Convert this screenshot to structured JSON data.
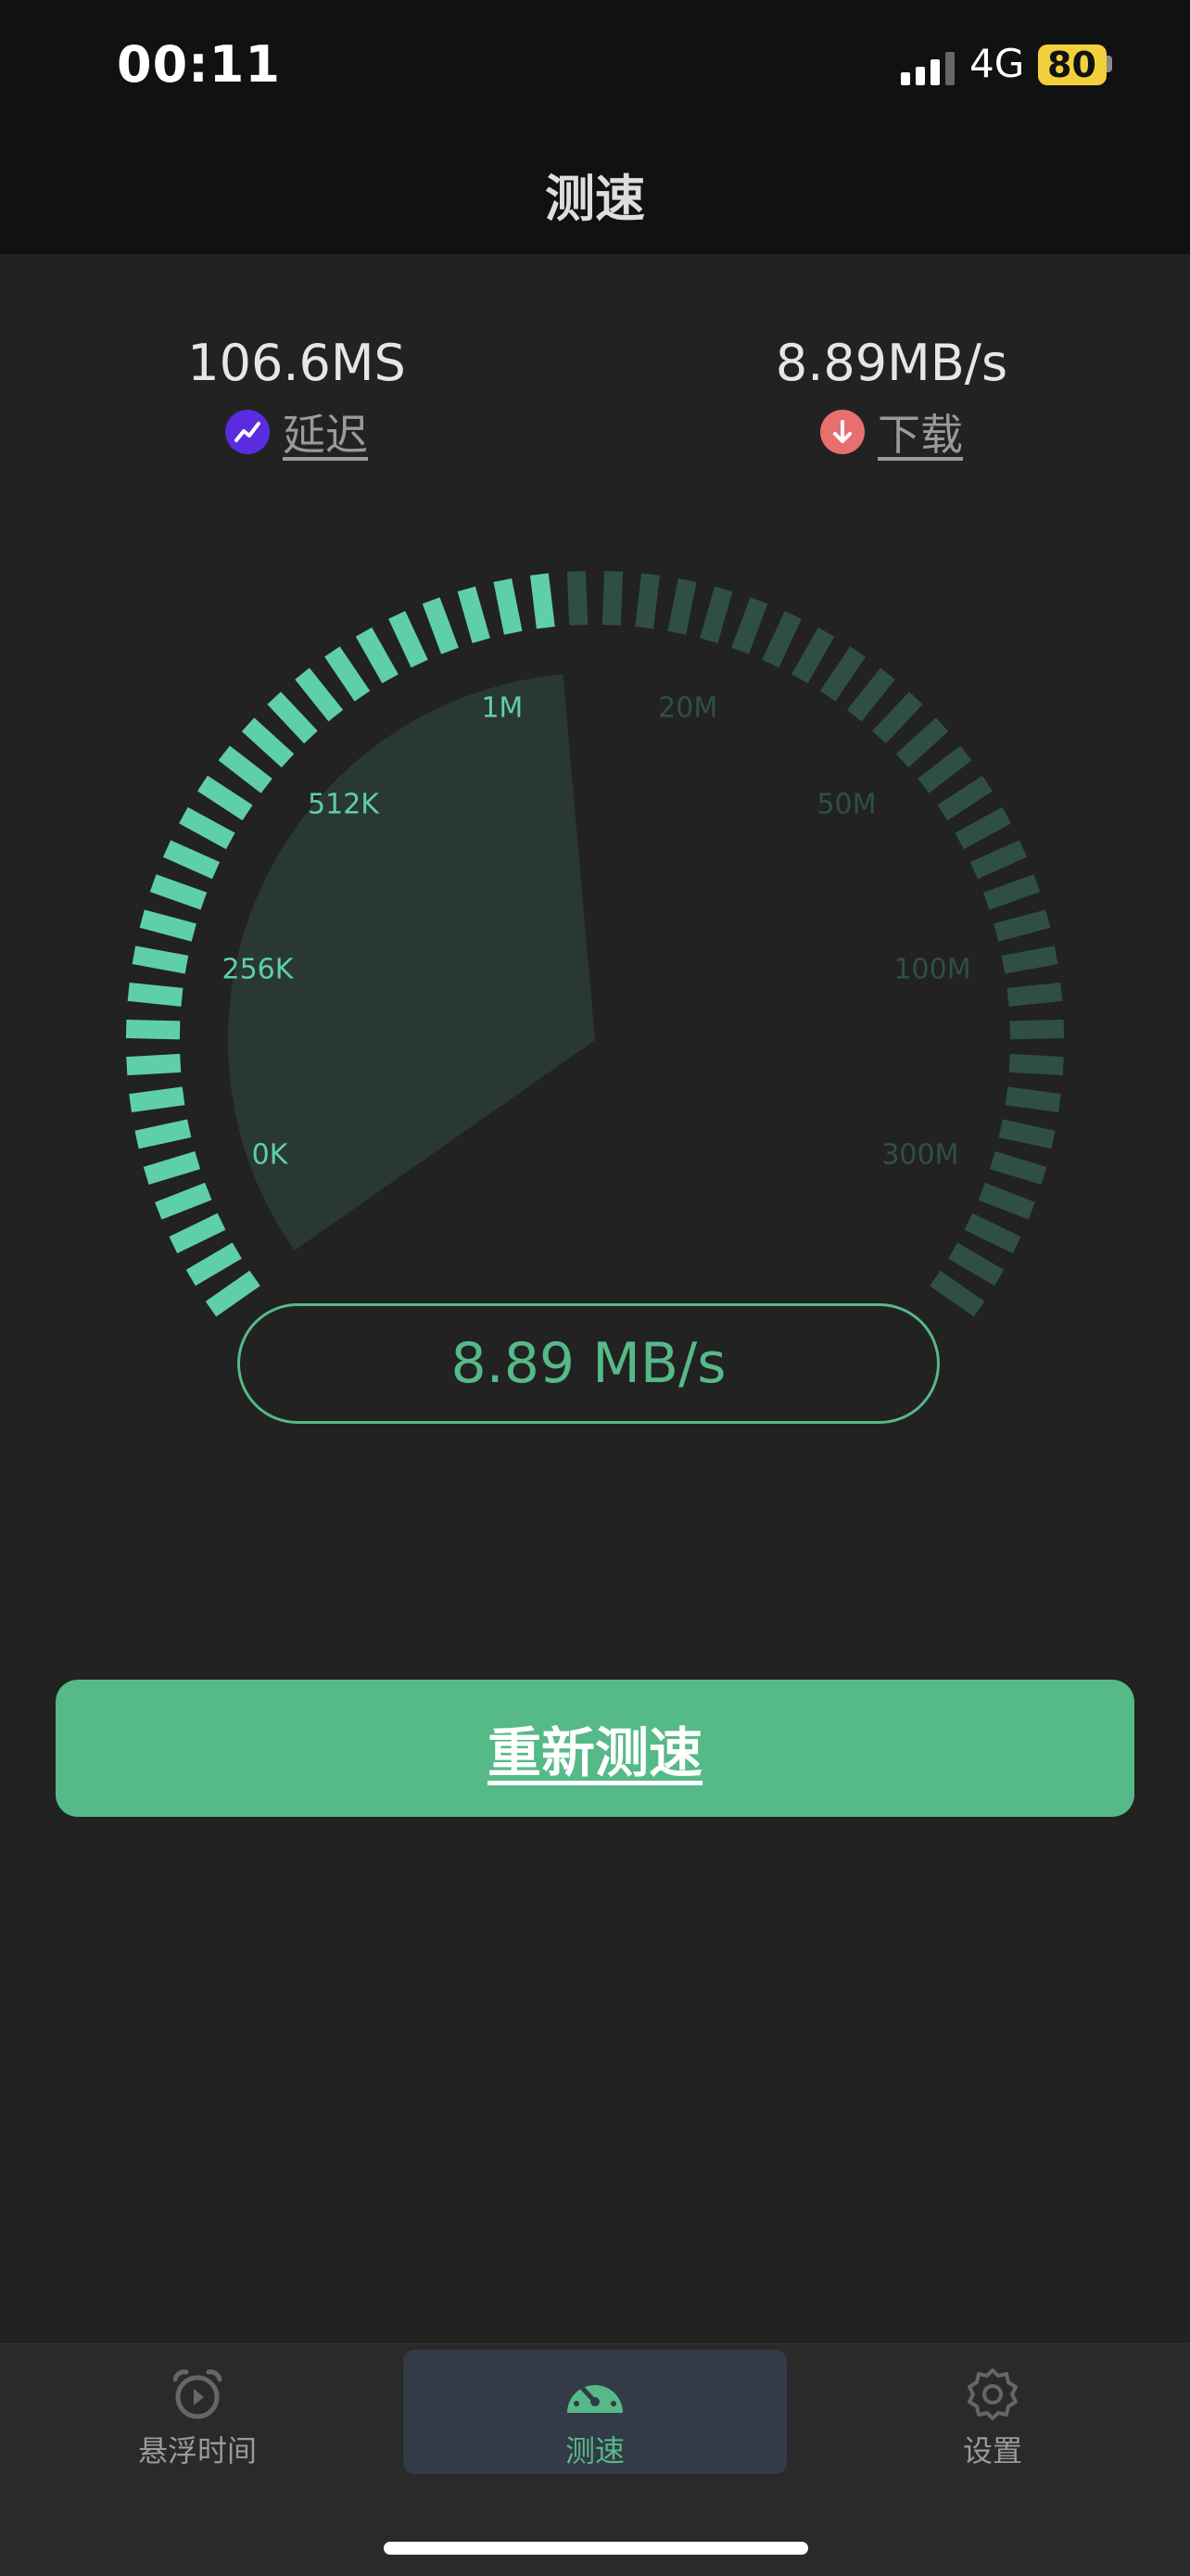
{
  "status_bar": {
    "time": "00:11",
    "network": "4G",
    "battery": "80"
  },
  "header": {
    "title": "测速"
  },
  "metrics": {
    "latency": {
      "value": "106.6MS",
      "label": "延迟",
      "icon": "trend-up-icon",
      "color": "#5b2be0"
    },
    "download": {
      "value": "8.89MB/s",
      "label": "下载",
      "icon": "arrow-down-icon",
      "color": "#e86f6f"
    }
  },
  "gauge": {
    "scale_labels": [
      "0K",
      "256K",
      "512K",
      "1M",
      "20M",
      "50M",
      "100M",
      "300M"
    ],
    "current_level": 0.48,
    "active_color": "#5fcfa8",
    "inactive_color": "#2f4f45"
  },
  "speed_display": {
    "value": "8.89 MB/s"
  },
  "actions": {
    "retest_label": "重新测速"
  },
  "tab_bar": {
    "tabs": [
      {
        "label": "悬浮时间",
        "icon": "alarm-clock-icon",
        "active": false
      },
      {
        "label": "测速",
        "icon": "speedometer-icon",
        "active": true
      },
      {
        "label": "设置",
        "icon": "gear-icon",
        "active": false
      }
    ]
  },
  "colors": {
    "accent": "#56b988",
    "background": "#222222",
    "header_background": "#111111"
  }
}
